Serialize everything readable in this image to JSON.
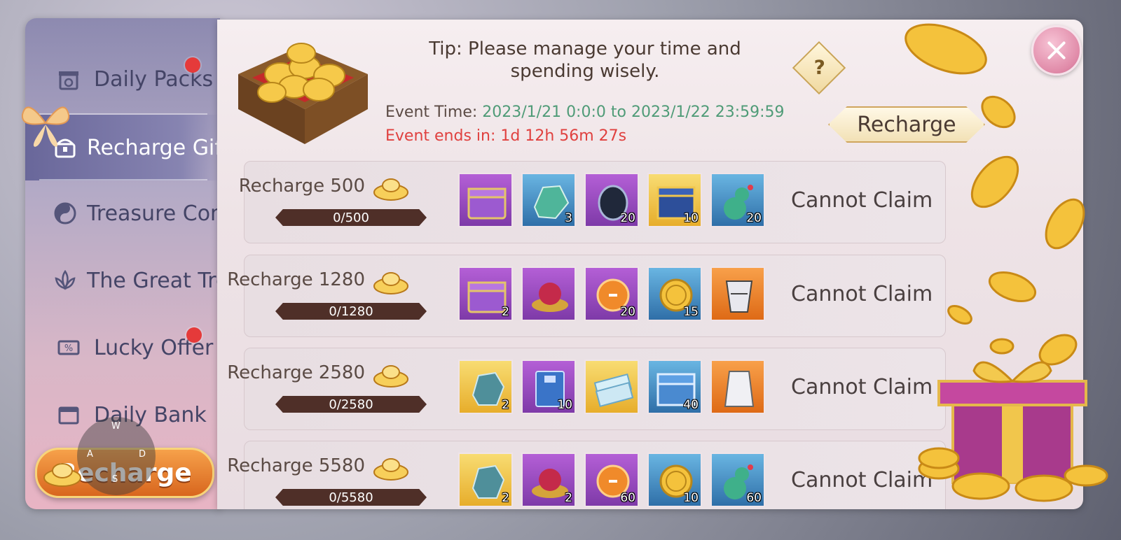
{
  "sidebar": {
    "items": [
      {
        "label": "Daily Packs",
        "icon": "gift-clock-icon",
        "badge": true
      },
      {
        "label": "Recharge Gift",
        "icon": "chest-icon",
        "active": true
      },
      {
        "label": "Treasure Compass",
        "icon": "yin-yang-icon"
      },
      {
        "label": "The Great Treasure",
        "icon": "lotus-icon"
      },
      {
        "label": "Lucky Offer",
        "icon": "percent-ticket-icon",
        "badge": true
      },
      {
        "label": "Daily Bank",
        "icon": "calendar-icon"
      }
    ],
    "recharge_label": "Recharge",
    "joystick": {
      "w": "W",
      "a": "A",
      "s": "S",
      "d": "D"
    }
  },
  "header": {
    "tip": "Tip: Please manage your time and spending wisely.",
    "event_time_label": "Event Time: ",
    "event_time_value": "2023/1/21 0:0:0 to 2023/1/22 23:59:59",
    "event_ends": "Event ends in: 1d 12h 56m 27s",
    "recharge_label": "Recharge",
    "help": "?"
  },
  "tiers": [
    {
      "label": "Recharge 500",
      "progress": "0/500",
      "status": "Cannot Claim",
      "items": [
        {
          "icon": "purple-chest-icon",
          "rarity": "purple",
          "qty": ""
        },
        {
          "icon": "jade-ore-icon",
          "rarity": "blue",
          "qty": "3"
        },
        {
          "icon": "dark-pearl-icon",
          "rarity": "purple",
          "qty": "20"
        },
        {
          "icon": "blue-gold-chest-icon",
          "rarity": "gold",
          "qty": "10"
        },
        {
          "icon": "green-gourd-icon",
          "rarity": "blue",
          "qty": "20"
        }
      ]
    },
    {
      "label": "Recharge 1280",
      "progress": "0/1280",
      "status": "Cannot Claim",
      "items": [
        {
          "icon": "purple-chest-icon",
          "rarity": "purple",
          "qty": "2"
        },
        {
          "icon": "berry-bowl-icon",
          "rarity": "purple",
          "qty": ""
        },
        {
          "icon": "orange-orb-icon",
          "rarity": "purple",
          "qty": "20"
        },
        {
          "icon": "gold-coin-icon",
          "rarity": "blue",
          "qty": "15"
        },
        {
          "icon": "armor-piece-icon",
          "rarity": "orange",
          "qty": ""
        }
      ]
    },
    {
      "label": "Recharge 2580",
      "progress": "0/2580",
      "status": "Cannot Claim",
      "items": [
        {
          "icon": "crystal-ore-icon",
          "rarity": "gold",
          "qty": "2"
        },
        {
          "icon": "blue-book-icon",
          "rarity": "purple",
          "qty": "10"
        },
        {
          "icon": "scroll-tickets-icon",
          "rarity": "gold",
          "qty": ""
        },
        {
          "icon": "blue-chest-icon",
          "rarity": "blue",
          "qty": "40"
        },
        {
          "icon": "white-armor-icon",
          "rarity": "orange",
          "qty": ""
        }
      ]
    },
    {
      "label": "Recharge 5580",
      "progress": "0/5580",
      "status": "Cannot Claim",
      "items": [
        {
          "icon": "crystal-ore-icon",
          "rarity": "gold",
          "qty": "2"
        },
        {
          "icon": "berry-bowl-icon",
          "rarity": "purple",
          "qty": "2"
        },
        {
          "icon": "orange-orb-icon",
          "rarity": "purple",
          "qty": "60"
        },
        {
          "icon": "gold-coin-icon",
          "rarity": "blue",
          "qty": "10"
        },
        {
          "icon": "green-gourd-icon",
          "rarity": "blue",
          "qty": "60"
        }
      ]
    }
  ],
  "colors": {
    "event_time": "#4f9b77",
    "event_ends": "#e0413f",
    "badge": "#e53a3a",
    "active_tab": "#7976a8"
  }
}
